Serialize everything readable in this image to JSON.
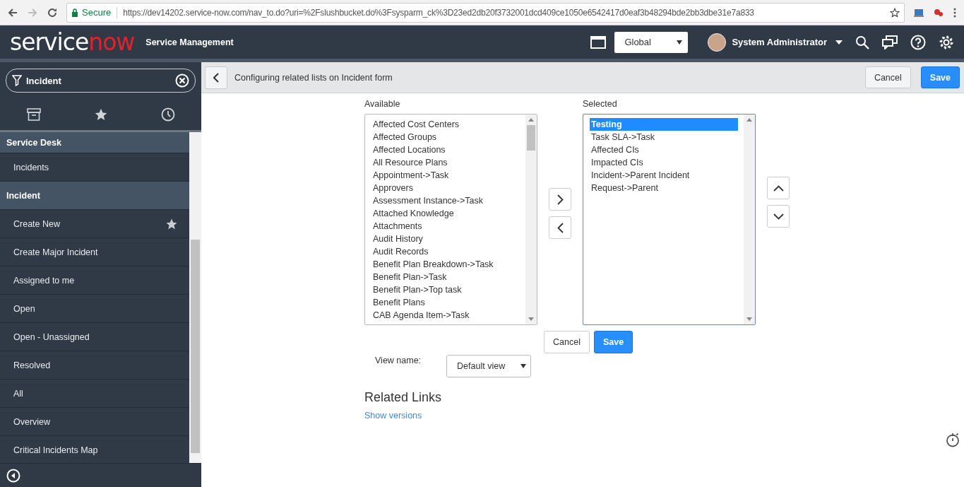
{
  "browser": {
    "secure_label": "Secure",
    "url": "https://dev14202.service-now.com/nav_to.do?uri=%2Fslushbucket.do%3Fsysparm_ck%3D23ed2db20f3732001dcd409ce1050e6542417d0eaf3b48294bde2bb3dbe31e7a833"
  },
  "header": {
    "logo": {
      "part_1": "service",
      "part_2": "now"
    },
    "product": "Service Management",
    "scope": "Global",
    "user": "System Administrator"
  },
  "sidebar": {
    "filter": {
      "value": "Incident"
    },
    "items": [
      {
        "kind": "section",
        "label": "Service Desk",
        "starred": false
      },
      {
        "kind": "module",
        "label": "Incidents",
        "starred": false
      },
      {
        "kind": "section",
        "label": "Incident",
        "starred": false
      },
      {
        "kind": "module",
        "label": "Create New",
        "starred": true
      },
      {
        "kind": "module",
        "label": "Create Major Incident",
        "starred": false
      },
      {
        "kind": "module",
        "label": "Assigned to me",
        "starred": false
      },
      {
        "kind": "module",
        "label": "Open",
        "starred": false
      },
      {
        "kind": "module",
        "label": "Open - Unassigned",
        "starred": false
      },
      {
        "kind": "module",
        "label": "Resolved",
        "starred": false
      },
      {
        "kind": "module",
        "label": "All",
        "starred": false
      },
      {
        "kind": "module",
        "label": "Overview",
        "starred": false
      },
      {
        "kind": "module",
        "label": "Critical Incidents Map",
        "starred": false
      }
    ]
  },
  "toolbar": {
    "title": "Configuring related lists on Incident form",
    "buttons": [
      {
        "label": "Cancel",
        "primary": false
      },
      {
        "label": "Save",
        "primary": true
      }
    ]
  },
  "available": {
    "label": "Available",
    "items": [
      {
        "label": "Affected Cost Centers",
        "selected": false
      },
      {
        "label": "Affected Groups",
        "selected": false
      },
      {
        "label": "Affected Locations",
        "selected": false
      },
      {
        "label": "All Resource Plans",
        "selected": false
      },
      {
        "label": "Appointment->Task",
        "selected": false
      },
      {
        "label": "Approvers",
        "selected": false
      },
      {
        "label": "Assessment Instance->Task",
        "selected": false
      },
      {
        "label": "Attached Knowledge",
        "selected": false
      },
      {
        "label": "Attachments",
        "selected": false
      },
      {
        "label": "Audit History",
        "selected": false
      },
      {
        "label": "Audit Records",
        "selected": false
      },
      {
        "label": "Benefit Plan Breakdown->Task",
        "selected": false
      },
      {
        "label": "Benefit Plan->Task",
        "selected": false
      },
      {
        "label": "Benefit Plan->Top task",
        "selected": false
      },
      {
        "label": "Benefit Plans",
        "selected": false
      },
      {
        "label": "CAB Agenda Item->Task",
        "selected": false
      }
    ]
  },
  "selected": {
    "label": "Selected",
    "items": [
      {
        "label": "Testing",
        "selected": true
      },
      {
        "label": "Task SLA->Task",
        "selected": false
      },
      {
        "label": "Affected CIs",
        "selected": false
      },
      {
        "label": "Impacted CIs",
        "selected": false
      },
      {
        "label": "Incident->Parent Incident",
        "selected": false
      },
      {
        "label": "Request->Parent",
        "selected": false
      }
    ]
  },
  "form_buttons": [
    {
      "label": "Cancel",
      "primary": false
    },
    {
      "label": "Save",
      "primary": true
    }
  ],
  "view_name": {
    "label": "View name:",
    "value": "Default view"
  },
  "related_links": {
    "title": "Related Links",
    "links": [
      "Show versions"
    ]
  }
}
